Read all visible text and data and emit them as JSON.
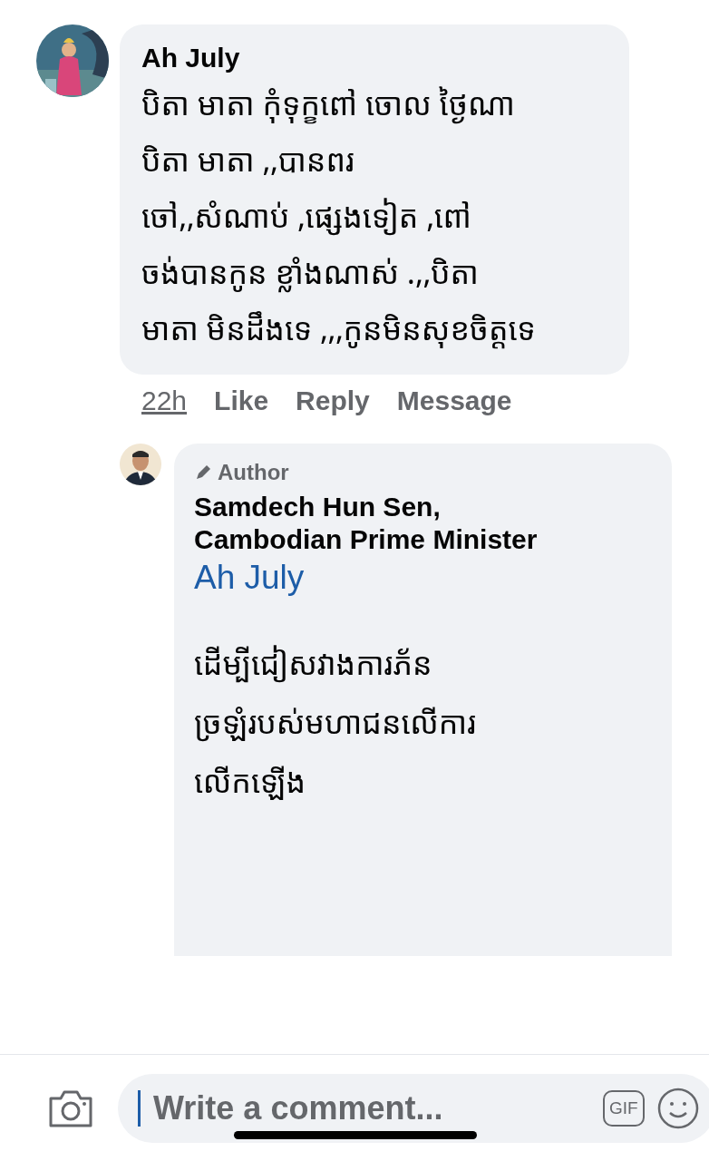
{
  "comments": [
    {
      "author": "Ah July",
      "text": "បិតា មាតា កុំទុក្ខពៅ ចោល ថ្ងៃណា\nបិតា មាតា ,,បានពរ\nចៅ,,សំណាប់ ,ផ្សេងទៀត ,ពៅ\nចង់បានកូន ខ្លាំងណាស់ .,,បិតា\nមាតា មិនដឹងទេ ,,,កូនមិនសុខចិត្តទេ",
      "time": "22h",
      "actions": [
        "Like",
        "Reply",
        "Message"
      ],
      "replies": [
        {
          "badge": "Author",
          "author": "Samdech Hun Sen,\nCambodian Prime Minister",
          "mention": "Ah July",
          "text": "ដើម្បីជៀសវាងការភ័ន\nច្រឡំរបស់មហាជនលើការ\nលើកឡើង"
        }
      ]
    }
  ],
  "composer": {
    "placeholder": "Write a comment...",
    "gif": "GIF"
  }
}
